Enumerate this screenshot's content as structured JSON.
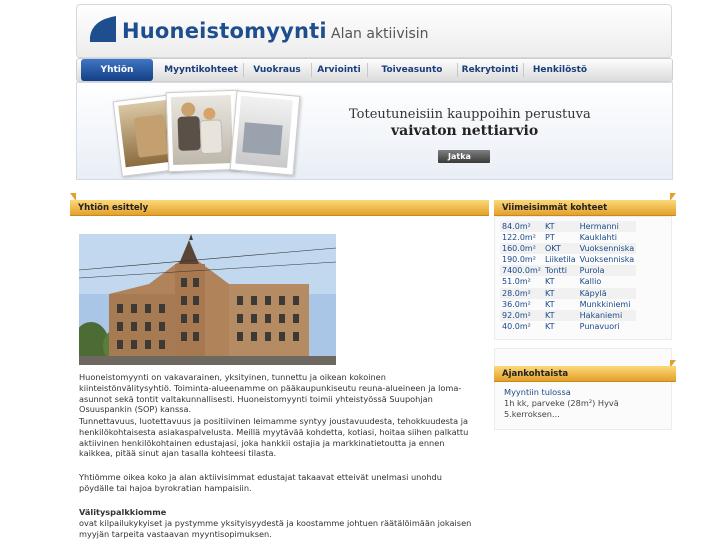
{
  "header": {
    "logo_text": "Huoneistomyynti",
    "tagline": "Alan aktiivisin"
  },
  "nav": {
    "items": [
      {
        "label": "Yhtiön esittely",
        "active": true
      },
      {
        "label": "Myyntikohteet",
        "active": false
      },
      {
        "label": "Vuokraus",
        "active": false
      },
      {
        "label": "Arviointi",
        "active": false
      },
      {
        "label": "Toiveasunto",
        "active": false
      },
      {
        "label": "Rekrytointi",
        "active": false
      },
      {
        "label": "Henkilöstö",
        "active": false
      }
    ]
  },
  "banner": {
    "line1": "Toteutuneisiin kauppoihin perustuva",
    "line2": "vaivaton nettiarvio",
    "button_label": "Jatka"
  },
  "main": {
    "heading": "Yhtiön esittely",
    "paragraph1": "Huoneistomyynti on vakavarainen, yksityinen, tunnettu ja oikean kokoinen kiinteistönvälitysyhtiö. Toiminta-alueenamme on pääkaupunkiseutu reuna-alueineen ja loma-asunnot sekä tontit valtakunnallisesti. Huoneistomyynti toimii yhteistyössä Suupohjan Osuuspankin (SOP) kanssa.",
    "paragraph2": "Tunnettavuus, luotettavuus ja positiivinen leimamme syntyy joustavuudesta, tehokkuudesta ja henkilökohtaisesta asiakaspalvelusta. Meillä myytävää kohdetta, kotiasi, hoitaa siihen palkattu aktiivinen henkilökohtainen edustajasi, joka hankkii ostajia ja markkinatietoutta ja ennen kaikkea, pitää sinut ajan tasalla kohteesi tilasta.",
    "paragraph3": "Yhtiömme oikea koko ja alan aktiivisimmat edustajat takaavat etteivät unelmasi unohdu pöydälle tai hajoa byrokratian hampaisiin.",
    "paragraph4_title": "Välityspalkkiomme",
    "paragraph4": "ovat kilpailukykyiset ja pystymme yksityisyydestä ja koostamme johtuen räätälöimään jokaisen myyjän tarpeita vastaavan myyntisopimuksen."
  },
  "sidebar": {
    "listings_heading": "Viimeisimmät kohteet",
    "listings": [
      {
        "size": "84.0m²",
        "type": "KT",
        "area": "Hermanni"
      },
      {
        "size": "122.0m²",
        "type": "PT",
        "area": "Kauklahti"
      },
      {
        "size": "160.0m²",
        "type": "OKT",
        "area": "Vuoksenniska"
      },
      {
        "size": "190.0m²",
        "type": "Liiketila",
        "area": "Vuoksenniska"
      },
      {
        "size": "7400.0m²",
        "type": "Tontti",
        "area": "Purola"
      },
      {
        "size": "51.0m²",
        "type": "KT",
        "area": "Kallio"
      },
      {
        "size": "28.0m²",
        "type": "KT",
        "area": "Käpylä"
      },
      {
        "size": "36.0m²",
        "type": "KT",
        "area": "Munkkiniemi"
      },
      {
        "size": "92.0m²",
        "type": "KT",
        "area": "Hakaniemi"
      },
      {
        "size": "40.0m²",
        "type": "KT",
        "area": "Punavuori"
      }
    ],
    "news_heading": "Ajankohtaista",
    "news_title": "Myyntiin tulossa",
    "news_text": "1h kk, parveke (28m²) Hyvä 5.kerroksen..."
  },
  "colors": {
    "brand_blue": "#1f4e8e",
    "section_orange": "#e3a12b",
    "nav_active": "#1e4b95"
  }
}
